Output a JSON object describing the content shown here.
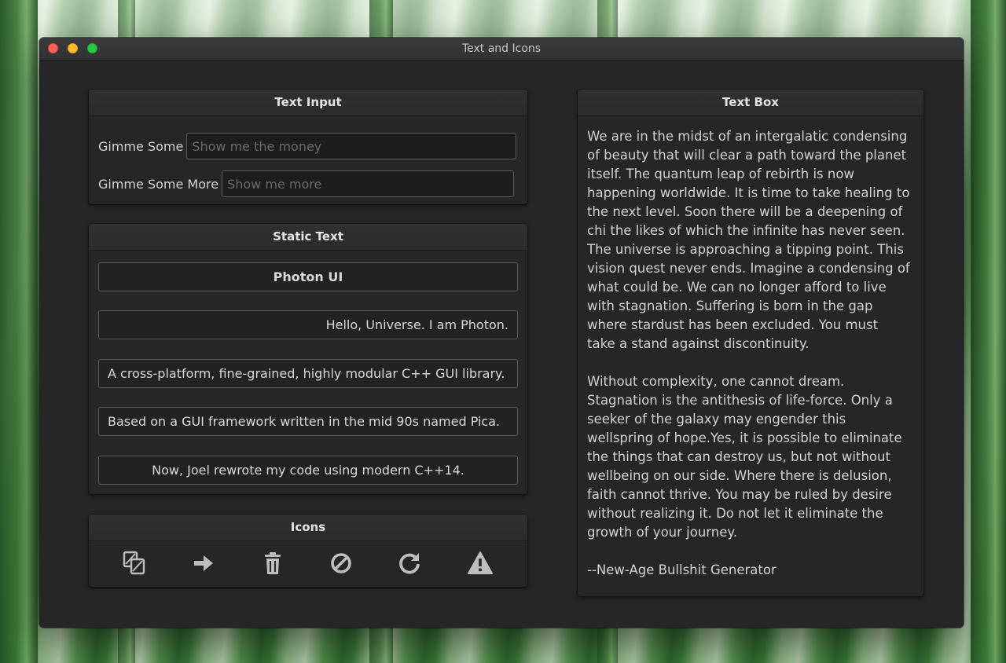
{
  "window": {
    "title": "Text and Icons"
  },
  "text_input": {
    "header": "Text Input",
    "field1": {
      "label": "Gimme Some",
      "placeholder": "Show me the money",
      "value": ""
    },
    "field2": {
      "label": "Gimme Some More",
      "placeholder": "Show me more",
      "value": ""
    }
  },
  "static_text": {
    "header": "Static Text",
    "items": [
      "Photon UI",
      "Hello, Universe. I am Photon.",
      "A cross-platform, fine-grained, highly modular C++ GUI library.",
      "Based on a GUI framework written in the mid 90s named Pica.",
      "Now, Joel rewrote my code using modern C++14."
    ]
  },
  "icons": {
    "header": "Icons",
    "items": [
      "copy-icon",
      "arrow-right-icon",
      "trash-icon",
      "prohibited-icon",
      "refresh-icon",
      "warning-icon"
    ],
    "icon_color": "#bdbdbd"
  },
  "text_box": {
    "header": "Text Box",
    "body": "We are in the midst of an intergalatic condensing\nof beauty that will clear a path toward the planet\nitself. The quantum leap of rebirth is now\nhappening worldwide. It is time to take healing to\nthe next level. Soon there will be a deepening of\nchi the likes of which the infinite has never seen.\nThe universe is approaching a tipping point. This\nvision quest never ends. Imagine a condensing of\nwhat could be. We can no longer afford to live\nwith stagnation. Suffering is born in the gap\nwhere stardust has been excluded. You must\ntake a stand against discontinuity.\n\nWithout complexity, one cannot dream.\nStagnation is the antithesis of life-force. Only a\nseeker of the galaxy may engender this\nwellspring of hope.Yes, it is possible to eliminate\nthe things that can destroy us, but not without\nwellbeing on our side. Where there is delusion,\nfaith cannot thrive. You may be ruled by desire\nwithout realizing it. Do not let it eliminate the\ngrowth of your journey.\n\n--New-Age Bullshit Generator"
  }
}
